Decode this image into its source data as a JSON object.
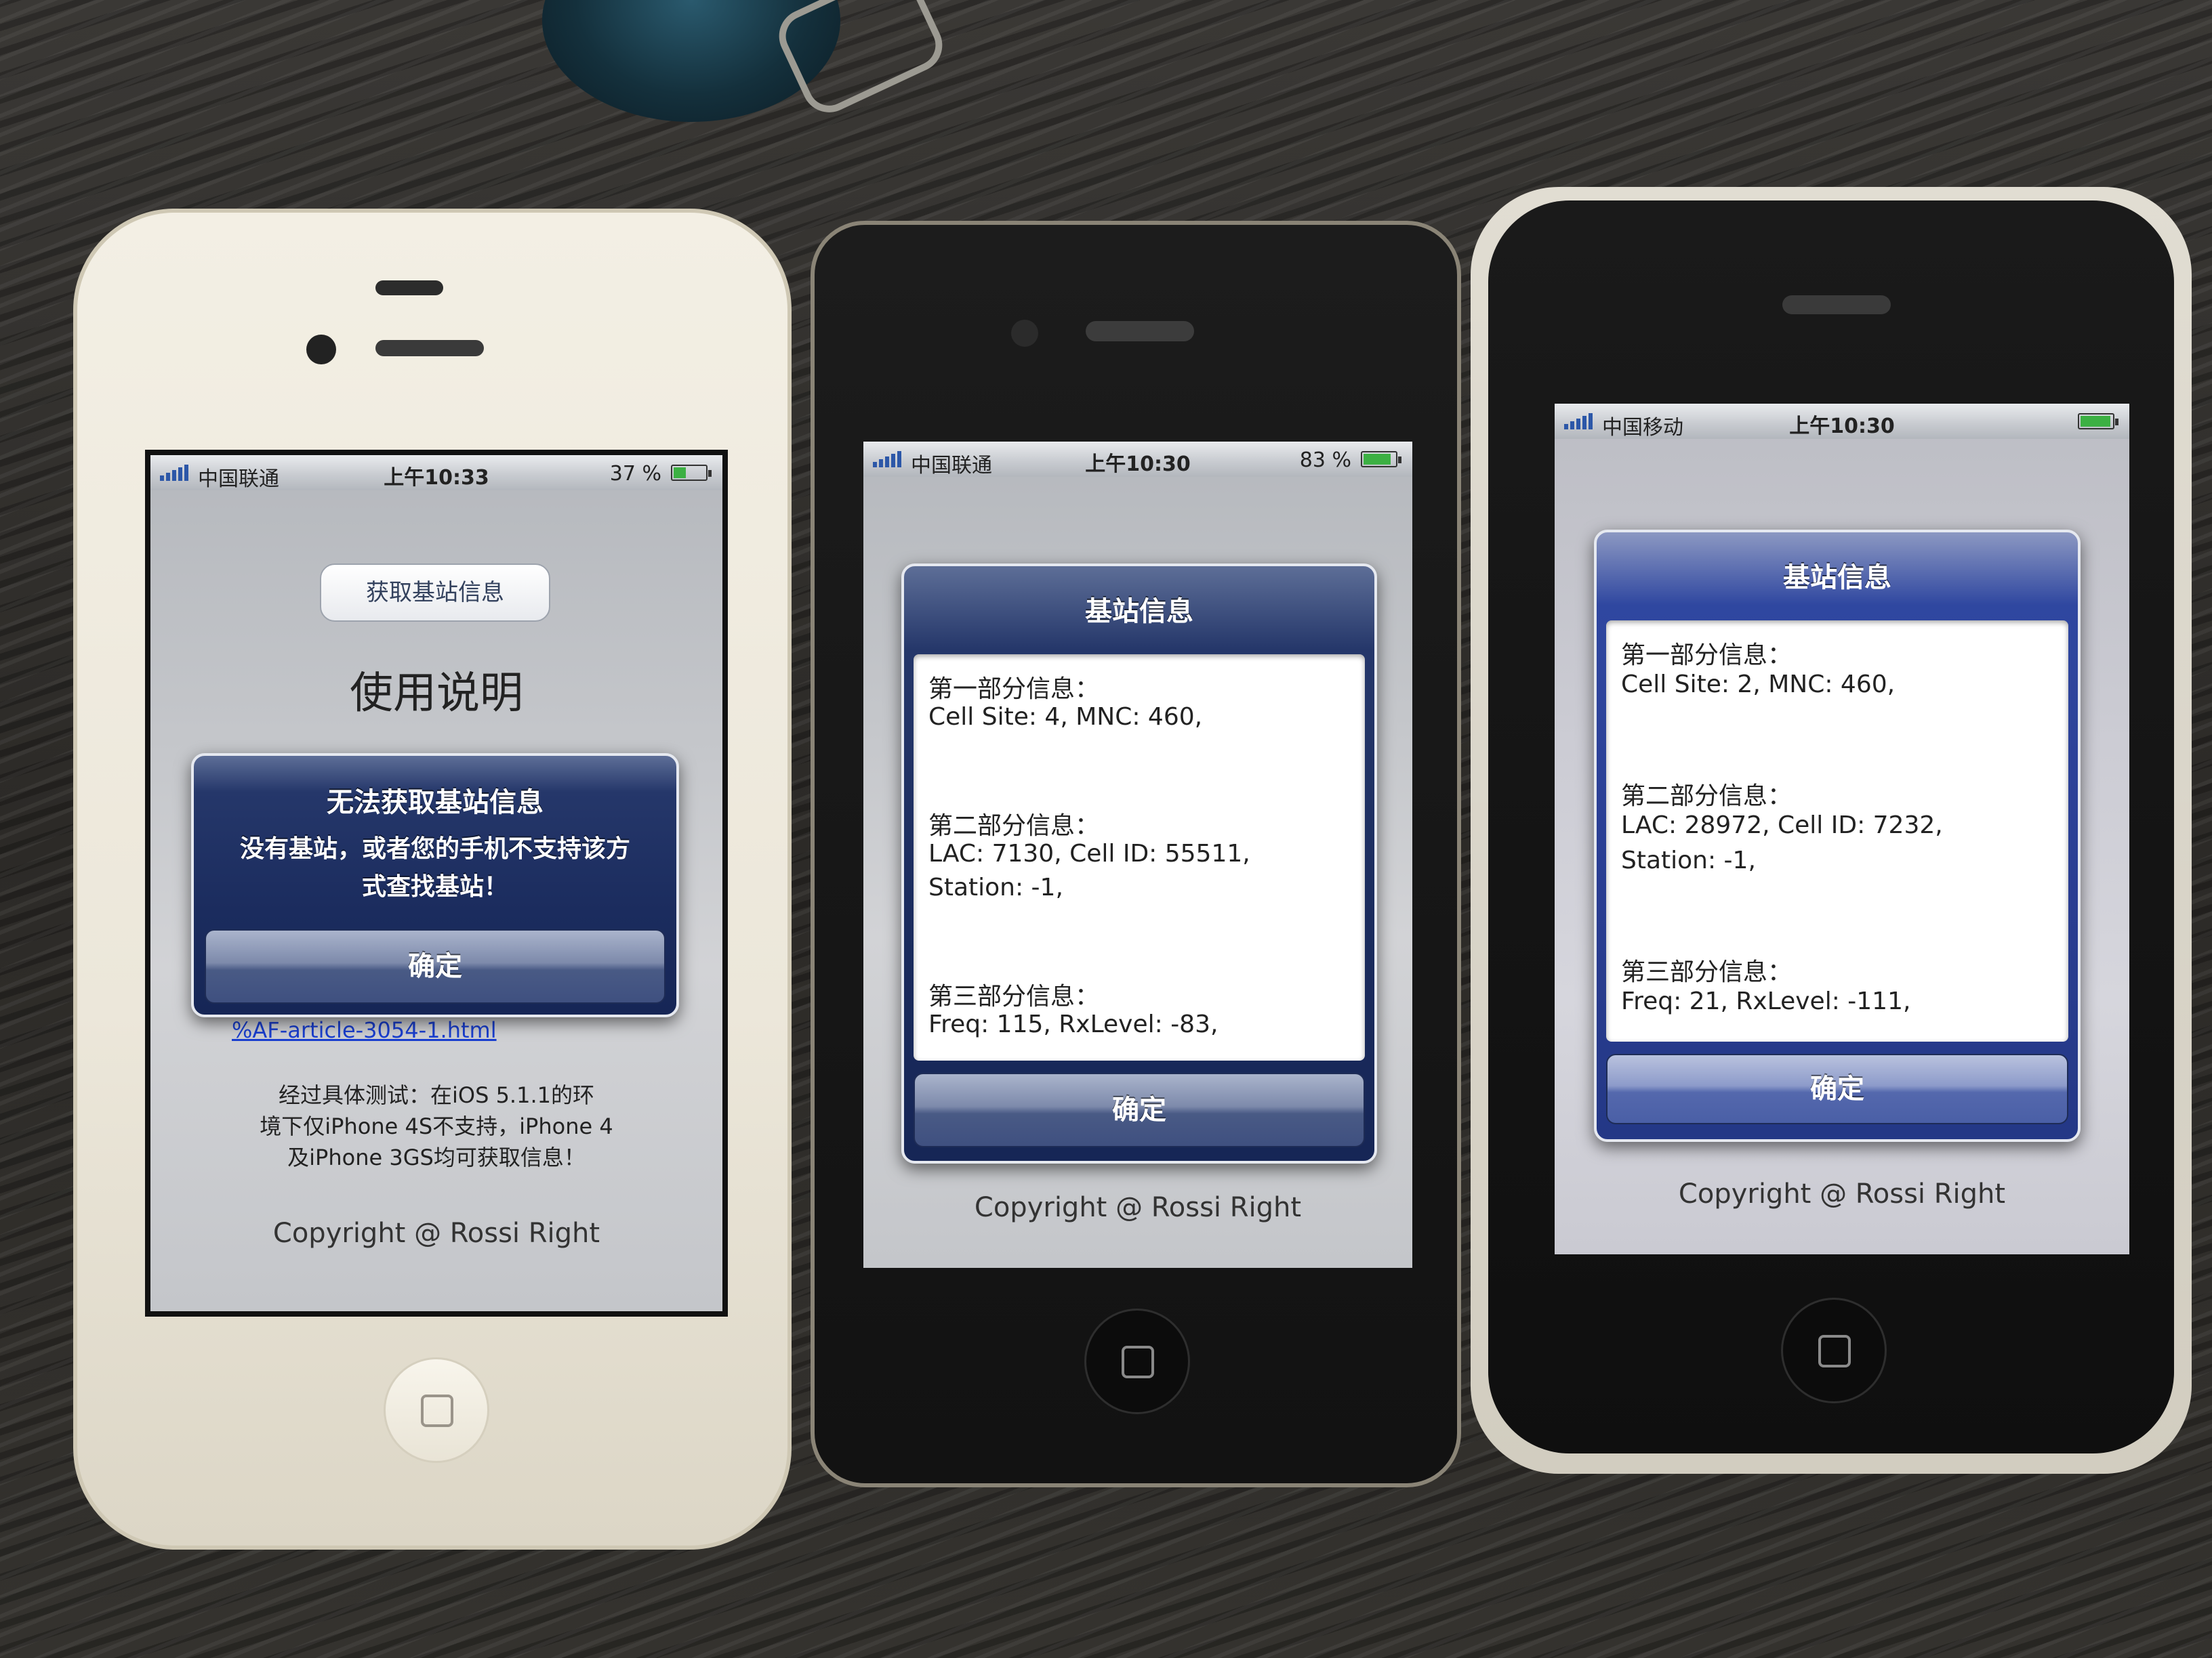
{
  "phone_left": {
    "status": {
      "carrier": "中国联通",
      "time": "上午10:33",
      "battery": "37 %",
      "battery_level": 0.37
    },
    "fetch_button": "获取基站信息",
    "heading": "使用说明",
    "link_line1": "%AF-article-3054-1.html",
    "note": [
      "经过具体测试：在iOS 5.1.1的环",
      "境下仅iPhone 4S不支持，iPhone 4",
      "及iPhone 3GS均可获取信息！"
    ],
    "copyright": "Copyright @ Rossi Right",
    "alert": {
      "title": "无法获取基站信息",
      "message_line1": "没有基站，或者您的手机不支持该方",
      "message_line2": "式查找基站！",
      "button": "确定"
    }
  },
  "phone_middle": {
    "status": {
      "carrier": "中国联通",
      "time": "上午10:30",
      "battery": "83 %",
      "battery_level": 0.83
    },
    "copyright": "Copyright @ Rossi Right",
    "alert": {
      "title": "基站信息",
      "lines": [
        "第一部分信息：",
        "Cell Site: 4, MNC: 460,",
        "第二部分信息：",
        "LAC: 7130, Cell ID: 55511,",
        "Station: -1,",
        "第三部分信息：",
        "Freq: 115, RxLevel: -83,"
      ],
      "button": "确定"
    }
  },
  "phone_right": {
    "status": {
      "carrier": "中国移动",
      "time": "上午10:30",
      "battery_level": 0.9
    },
    "copyright": "Copyright @ Rossi Right",
    "alert": {
      "title": "基站信息",
      "lines": [
        "第一部分信息：",
        "Cell Site: 2, MNC: 460,",
        "第二部分信息：",
        "LAC: 28972, Cell ID: 7232,",
        "Station: -1,",
        "第三部分信息：",
        "Freq: 21, RxLevel: -111,"
      ],
      "button": "确定"
    }
  }
}
